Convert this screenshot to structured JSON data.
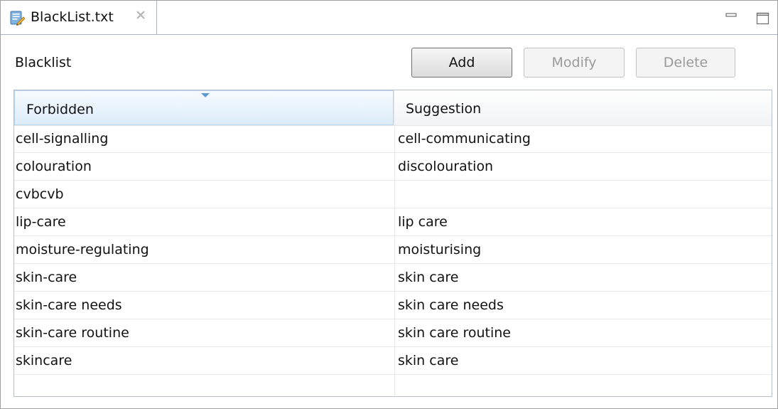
{
  "tab": {
    "title": "BlackList.txt",
    "close_glyph": "☒",
    "icon": "edit-document-icon"
  },
  "window_controls": {
    "minimize_icon": "minimize-icon",
    "maximize_icon": "maximize-icon"
  },
  "section": {
    "label": "Blacklist"
  },
  "toolbar": {
    "add_label": "Add",
    "modify_label": "Modify",
    "delete_label": "Delete",
    "modify_enabled": false,
    "delete_enabled": false
  },
  "table": {
    "columns": [
      "Forbidden",
      "Suggestion"
    ],
    "sorted_column": "Forbidden",
    "sort_direction": "descending-indicator",
    "rows": [
      {
        "forbidden": "cell-signalling",
        "suggestion": "cell-communicating"
      },
      {
        "forbidden": "colouration",
        "suggestion": "discolouration"
      },
      {
        "forbidden": "cvbcvb",
        "suggestion": ""
      },
      {
        "forbidden": "lip-care",
        "suggestion": "lip care"
      },
      {
        "forbidden": "moisture-regulating",
        "suggestion": "moisturising"
      },
      {
        "forbidden": "skin-care",
        "suggestion": "skin care"
      },
      {
        "forbidden": "skin-care needs",
        "suggestion": "skin care needs"
      },
      {
        "forbidden": "skin-care routine",
        "suggestion": "skin care routine"
      },
      {
        "forbidden": "skincare",
        "suggestion": "skin care"
      },
      {
        "forbidden": "",
        "suggestion": ""
      }
    ]
  },
  "colors": {
    "header_selected_bg": "#dcecf9",
    "sort_arrow": "#5d9ad4",
    "disabled_text": "#9a9a9a",
    "border": "#a9b3c1"
  }
}
